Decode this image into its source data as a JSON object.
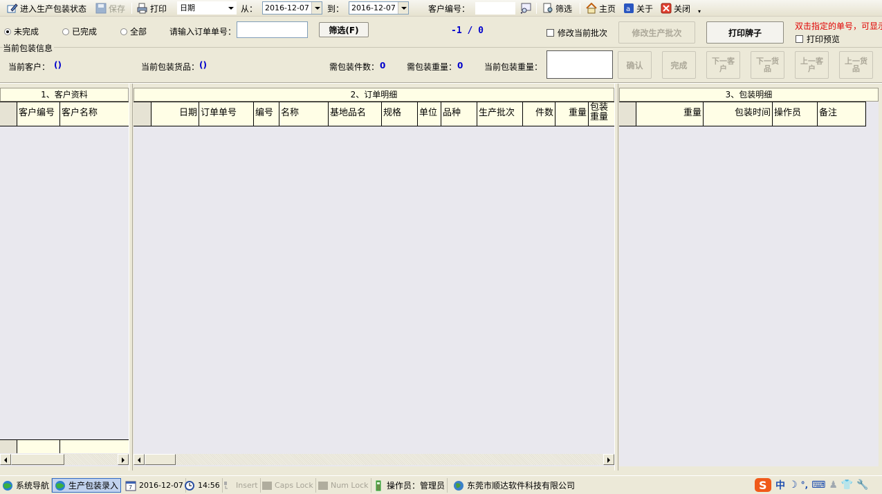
{
  "toolbar": {
    "enter_state": "进入生产包装状态",
    "save": "保存",
    "print": "打印",
    "date_field": "日期",
    "from_label": "从：",
    "from_date": "2016-12-07",
    "to_label": "到：",
    "to_date": "2016-12-07",
    "customer_no_label": "客户编号：",
    "customer_no_value": "",
    "filter": "筛选",
    "home": "主页",
    "about": "关于",
    "close": "关闭"
  },
  "filters": {
    "radios": [
      {
        "label": "未完成",
        "checked": true
      },
      {
        "label": "已完成",
        "checked": false
      },
      {
        "label": "全部",
        "checked": false
      }
    ],
    "order_no_label": "请输入订单单号：",
    "order_no_value": "",
    "filter_button": "筛选(F)",
    "counter": "-1 / 0",
    "modify_batch_checkbox": "修改当前批次",
    "modify_batch_button": "修改生产批次",
    "print_tag_button": "打印牌子",
    "hint": "双击指定的单号，可显示",
    "print_preview_checkbox": "打印预览"
  },
  "packing_info": {
    "group_title": "当前包装信息",
    "current_customer_label": "当前客户：",
    "current_customer_value": "()",
    "current_goods_label": "当前包装货品：",
    "current_goods_value": "()",
    "pieces_label": "需包装件数：",
    "pieces_value": "0",
    "weight_needed_label": "需包装重量：",
    "weight_needed_value": "0",
    "current_weight_label": "当前包装重量：",
    "current_weight_value": "",
    "buttons": {
      "confirm": "确认",
      "finish": "完成",
      "next_customer": [
        "下一客",
        "户"
      ],
      "next_goods": [
        "下一货",
        "品"
      ],
      "prev_customer": [
        "上一客",
        "户"
      ],
      "prev_goods": [
        "上一货",
        "品"
      ]
    }
  },
  "panels": {
    "customers": {
      "title": "1、客户资料",
      "columns": [
        "客户编号",
        "客户名称"
      ]
    },
    "orders": {
      "title": "2、订单明细",
      "columns": [
        "日期",
        "订单单号",
        "编号",
        "名称",
        "基地品名",
        "规格",
        "单位",
        "品种",
        "生产批次",
        "件数",
        "重量",
        "包装重量"
      ]
    },
    "packing": {
      "title": "3、包装明细",
      "columns": [
        "重量",
        "包装时间",
        "操作员",
        "备注"
      ]
    }
  },
  "statusbar": {
    "nav": "系统导航",
    "active_window": "生产包装录入",
    "date": "2016-12-07",
    "time": "14:56",
    "insert": "Insert",
    "caps": "Caps Lock",
    "num": "Num Lock",
    "operator": "操作员：管理员",
    "company": "东莞市顺达软件科技有限公司",
    "ime": "中"
  }
}
